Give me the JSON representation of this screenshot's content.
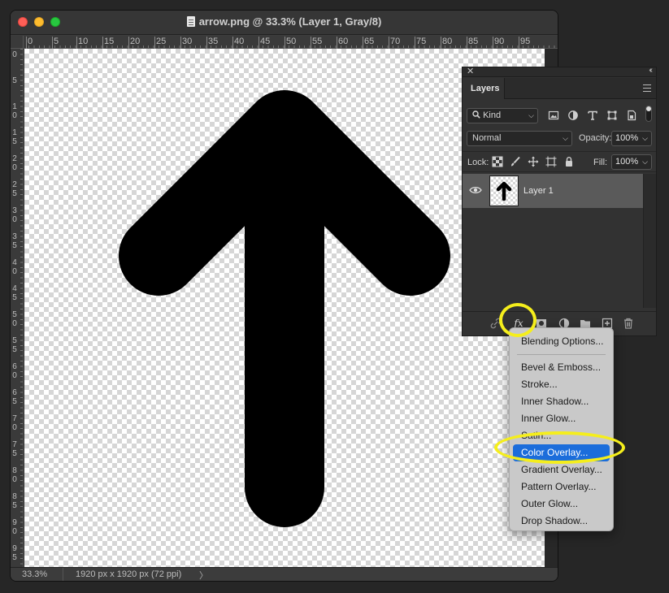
{
  "window": {
    "title": "arrow.png @ 33.3% (Layer 1, Gray/8)"
  },
  "rulers": {
    "top": [
      "0",
      "5",
      "10",
      "15",
      "20",
      "25",
      "30",
      "35",
      "40",
      "45",
      "50",
      "55",
      "60",
      "65",
      "70",
      "75",
      "80",
      "85",
      "90",
      "95"
    ],
    "left": [
      "0",
      "5",
      "10",
      "15",
      "20",
      "25",
      "30",
      "35",
      "40",
      "45",
      "50",
      "55",
      "60",
      "65",
      "70",
      "75",
      "80",
      "85",
      "90",
      "95"
    ]
  },
  "status_bar": {
    "zoom": "33.3%",
    "doc_info": "1920 px x 1920 px (72 ppi)",
    "expand_arrow": "〉"
  },
  "layers_panel": {
    "close": "✕",
    "collapse": "‹‹",
    "tab_label": "Layers",
    "filter_kind": "Kind",
    "filter_icons": [
      "image-filter-icon",
      "adjustment-filter-icon",
      "type-filter-icon",
      "shape-filter-icon",
      "smart-object-filter-icon"
    ],
    "blend_mode": "Normal",
    "opacity_label": "Opacity:",
    "opacity_value": "100%",
    "lock_label": "Lock:",
    "fill_label": "Fill:",
    "fill_value": "100%",
    "layers": [
      {
        "name": "Layer 1",
        "visible": true,
        "selected": true
      }
    ],
    "bottom_icons": [
      "link-layers-icon",
      "fx-icon",
      "add-mask-icon",
      "adjustment-layer-icon",
      "new-group-icon",
      "new-layer-icon",
      "trash-icon"
    ],
    "fx_label": "fx"
  },
  "fx_menu": {
    "items": [
      "Blending Options...",
      "Bevel & Emboss...",
      "Stroke...",
      "Inner Shadow...",
      "Inner Glow...",
      "Satin...",
      "Color Overlay...",
      "Gradient Overlay...",
      "Pattern Overlay...",
      "Outer Glow...",
      "Drop Shadow..."
    ],
    "highlighted": "Color Overlay..."
  },
  "colors": {
    "annotation_highlight": "#f5ee1c",
    "menu_selection": "#1b6ddb",
    "arrow_fill": "#000000"
  }
}
